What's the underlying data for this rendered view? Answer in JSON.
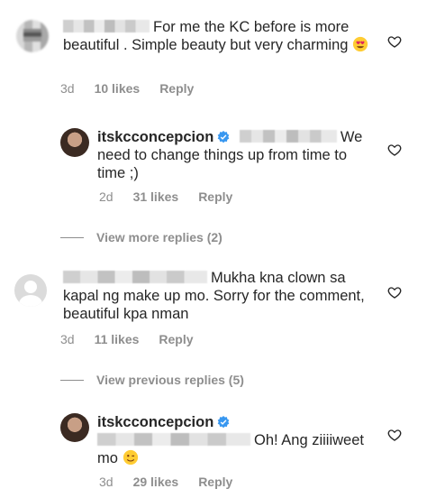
{
  "comments": [
    {
      "text": "For me the KC before is more beautiful . Simple beauty but very charming",
      "time": "3d",
      "likes": "10 likes",
      "reply": "Reply"
    },
    {
      "username": "itskcconcepcion",
      "text": "We need to change things up from time to time ;)",
      "time": "2d",
      "likes": "31 likes",
      "reply": "Reply"
    },
    {
      "text": "Mukha kna clown sa kapal ng make up mo. Sorry for the comment, beautiful kpa nman",
      "time": "3d",
      "likes": "11 likes",
      "reply": "Reply"
    },
    {
      "username": "itskcconcepcion",
      "text": "Oh! Ang ziiiiweet mo",
      "time": "3d",
      "likes": "29 likes",
      "reply": "Reply"
    }
  ],
  "view_more_replies": "View more replies (2)",
  "view_previous_replies": "View previous replies (5)",
  "icons": {
    "heart": "heart-outline-icon",
    "verified": "verified-badge-icon",
    "heart_eyes": "heart-eyes-emoji",
    "wink": "wink-emoji"
  },
  "colors": {
    "verified": "#3897f0",
    "meta_text": "#8e8e8e",
    "text": "#262626"
  }
}
